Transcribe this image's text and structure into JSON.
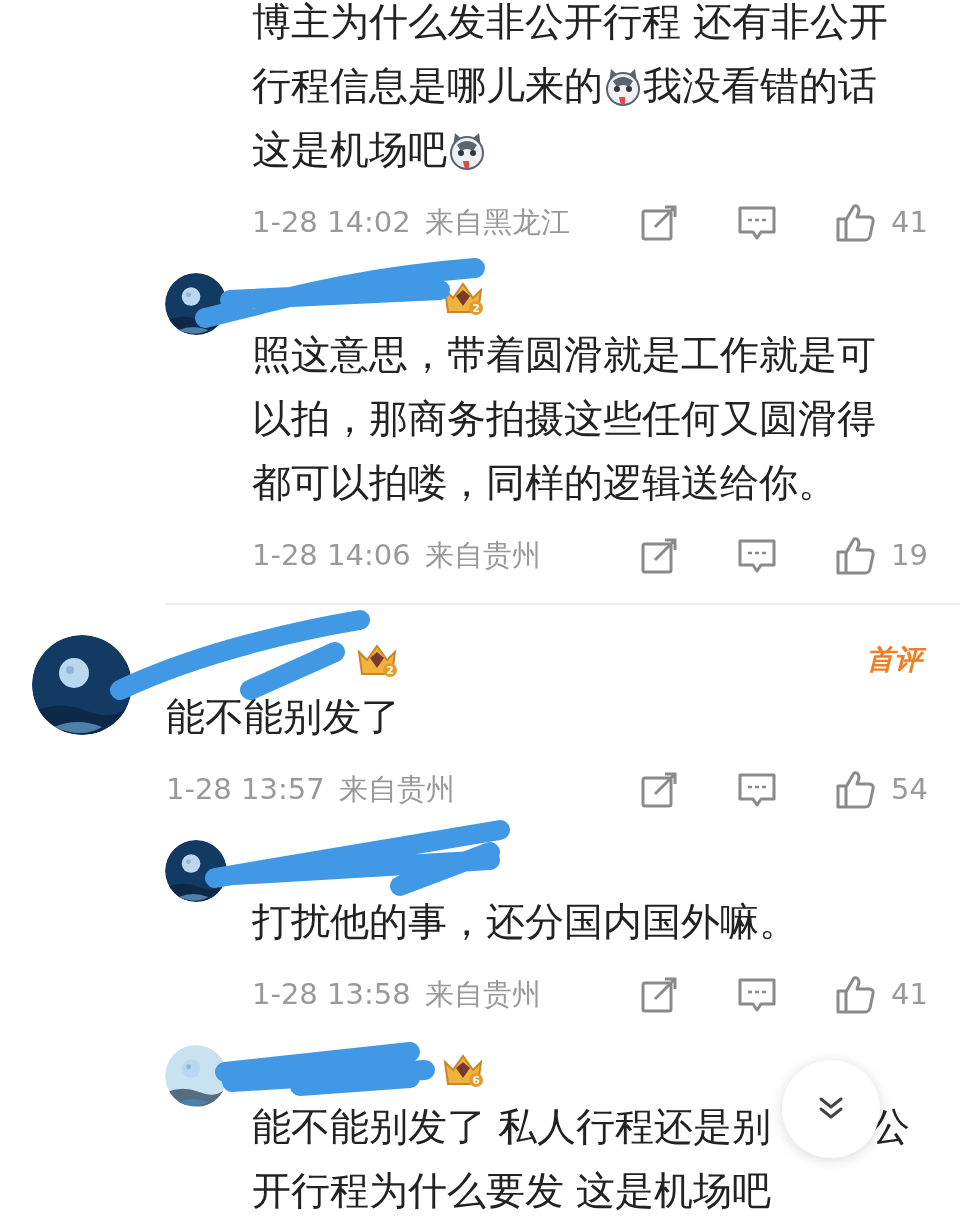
{
  "comments": [
    {
      "kind": "reply",
      "body": [
        {
          "kind": "text",
          "text": "博主为什么发非公开行程 还有非公开"
        },
        {
          "kind": "break"
        },
        {
          "kind": "text",
          "text": "行程信息是哪儿来的"
        },
        {
          "kind": "emoji"
        },
        {
          "kind": "text",
          "text": "我没看错的话"
        },
        {
          "kind": "break"
        },
        {
          "kind": "text",
          "text": "这是机场吧"
        },
        {
          "kind": "emoji"
        }
      ],
      "time": "1-28 14:02",
      "location": "来自黑龙江",
      "likes": "41"
    },
    {
      "kind": "reply",
      "badge": {
        "level": "2"
      },
      "body": [
        {
          "kind": "text",
          "text": "照这意思，带着圆滑就是工作就是可以拍，那商务拍摄这些任何又圆滑得都可以拍喽，同样的逻辑送给你。"
        }
      ],
      "time": "1-28 14:06",
      "location": "来自贵州",
      "likes": "19"
    },
    {
      "kind": "top",
      "badge": {
        "level": "2"
      },
      "tag": "首评",
      "body": [
        {
          "kind": "text",
          "text": "能不能别发了"
        }
      ],
      "time": "1-28 13:57",
      "location": "来自贵州",
      "likes": "54"
    },
    {
      "kind": "reply",
      "body": [
        {
          "kind": "text",
          "text": "打扰他的事，还分国内国外嘛。"
        }
      ],
      "time": "1-28 13:58",
      "location": "来自贵州",
      "likes": "41"
    },
    {
      "kind": "reply",
      "badge": {
        "level": "6"
      },
      "body": [
        {
          "kind": "text",
          "text": "能不能别发了 私人行程还是别"
        },
        {
          "kind": "gap"
        },
        {
          "kind": "text",
          "text": "公"
        },
        {
          "kind": "break"
        },
        {
          "kind": "text",
          "text": "开行程为什么要发 这是机场吧"
        }
      ]
    }
  ]
}
